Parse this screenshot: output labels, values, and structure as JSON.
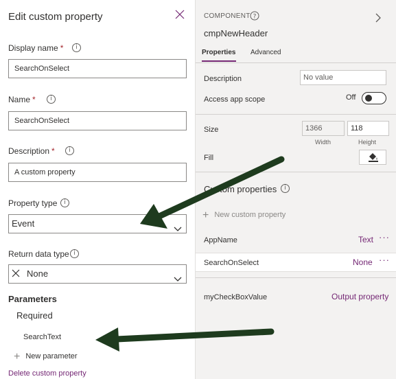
{
  "left_panel": {
    "title": "Edit custom property",
    "display_name": {
      "label": "Display name",
      "required_mark": "*",
      "value": "SearchOnSelect"
    },
    "name": {
      "label": "Name",
      "required_mark": "*",
      "value": "SearchOnSelect"
    },
    "description": {
      "label": "Description",
      "required_mark": "*",
      "value": "A custom property"
    },
    "property_type": {
      "label": "Property type",
      "selected": "Event"
    },
    "return_data_type": {
      "label": "Return data type",
      "selected": "None"
    },
    "parameters": {
      "heading": "Parameters",
      "required_label": "Required",
      "items": [
        "SearchText"
      ],
      "new_label": "New parameter"
    },
    "delete_label": "Delete custom property"
  },
  "right_panel": {
    "kicker": "COMPONENT",
    "component_name": "cmpNewHeader",
    "tabs": [
      {
        "label": "Properties",
        "active": true
      },
      {
        "label": "Advanced",
        "active": false
      }
    ],
    "description": {
      "label": "Description",
      "placeholder": "No value"
    },
    "access_app_scope": {
      "label": "Access app scope",
      "state_label": "Off"
    },
    "size": {
      "label": "Size",
      "width": "1366",
      "height": "118",
      "width_label": "Width",
      "height_label": "Height"
    },
    "fill": {
      "label": "Fill"
    },
    "custom_properties": {
      "title": "Custom properties",
      "new_label": "New custom property",
      "items": [
        {
          "name": "AppName",
          "type": "Text",
          "more": "···"
        },
        {
          "name": "SearchOnSelect",
          "type": "None",
          "more": "···"
        },
        {
          "name": "myCheckBoxValue",
          "type": "Output property",
          "more": ""
        }
      ]
    }
  },
  "colors": {
    "accent": "#742774",
    "required": "#a4262c",
    "arrow": "#1e3b1e"
  },
  "icons": [
    "close-icon",
    "info-icon",
    "chevron-down-icon",
    "x-icon",
    "plus-icon",
    "chevron-right-icon",
    "question-icon",
    "paint-bucket-icon"
  ]
}
